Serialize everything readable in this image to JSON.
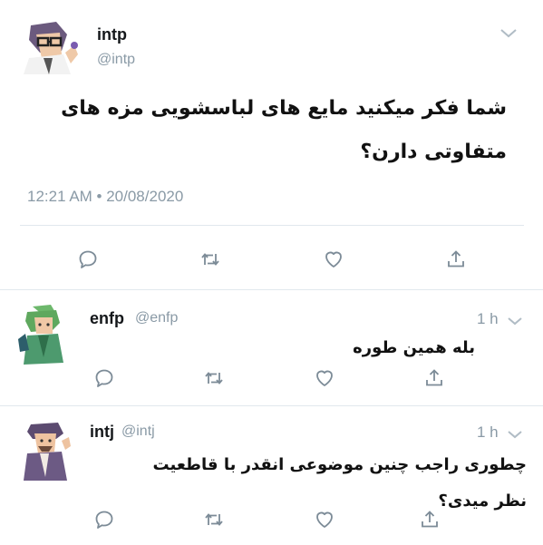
{
  "colors": {
    "text": "#14171a",
    "secondary": "#8a9aa6",
    "divider": "#e1e8ed"
  },
  "main_tweet": {
    "display_name": "intp",
    "handle": "@intp",
    "text_line1": "شما فکر میکنید مایع های لباسشویی مزه های",
    "text_line2": "متفاوتی دارن؟",
    "timestamp": "12:21 AM • 20/08/2020"
  },
  "replies": [
    {
      "display_name": "enfp",
      "handle": "@enfp",
      "time": "1 h",
      "text_lines": [
        "بله همین طوره"
      ]
    },
    {
      "display_name": "intj",
      "handle": "@intj",
      "time": "1 h",
      "text_lines": [
        "چطوری راجب چنین موضوعی انقدر با قاطعیت",
        "نظر میدی؟"
      ]
    }
  ],
  "icons": [
    "reply-icon",
    "retweet-icon",
    "like-icon",
    "share-icon",
    "chevron-down-icon"
  ]
}
